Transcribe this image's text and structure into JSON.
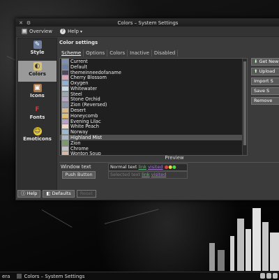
{
  "window": {
    "title": "Colors – System Settings"
  },
  "toolbar": {
    "overview_label": "Overview",
    "help_label": "Help"
  },
  "sidebar": {
    "items": [
      {
        "label": "Style",
        "icon": "style-icon"
      },
      {
        "label": "Colors",
        "icon": "colors-icon"
      },
      {
        "label": "Icons",
        "icon": "icons-icon"
      },
      {
        "label": "Fonts",
        "icon": "fonts-icon"
      },
      {
        "label": "Emoticons",
        "icon": "emoticons-icon"
      }
    ]
  },
  "main": {
    "heading": "Color settings",
    "tabs": [
      "Scheme",
      "Options",
      "Colors",
      "Inactive",
      "Disabled"
    ],
    "schemes": [
      "Current",
      "Default",
      "themeinneedofaname",
      "Cherry Blossom",
      "Oxygen",
      "Whitewater",
      "Steel",
      "Stone Orchid",
      "Zion (Reversed)",
      "Desert",
      "Honeycomb",
      "Evening Lilac",
      "White Peach",
      "Norway",
      "Highland Mist",
      "Zion",
      "Chrome",
      "Wonton Soup"
    ],
    "selected_scheme": "Highland Mist",
    "buttons": {
      "get_new": "Get New",
      "upload": "Upload",
      "import": "Import S",
      "save": "Save S",
      "remove": "Remove"
    }
  },
  "preview": {
    "header": "Preview",
    "window_text_label": "Window text",
    "push_button_label": "Push Button",
    "normal": {
      "text": "Normal text",
      "link": "link",
      "visited": "visited"
    },
    "selected": {
      "text": "Selected text",
      "link": "link",
      "visited": "visited"
    }
  },
  "bottom": {
    "help_label": "Help",
    "defaults_label": "Defaults",
    "reset_label": "Reset"
  },
  "taskbar": {
    "item1": "era",
    "item2": "Colors – System Settings"
  },
  "colors": {
    "link": "#5fbf7a",
    "visited": "#a07acc",
    "selection": "#4f4f4f"
  }
}
